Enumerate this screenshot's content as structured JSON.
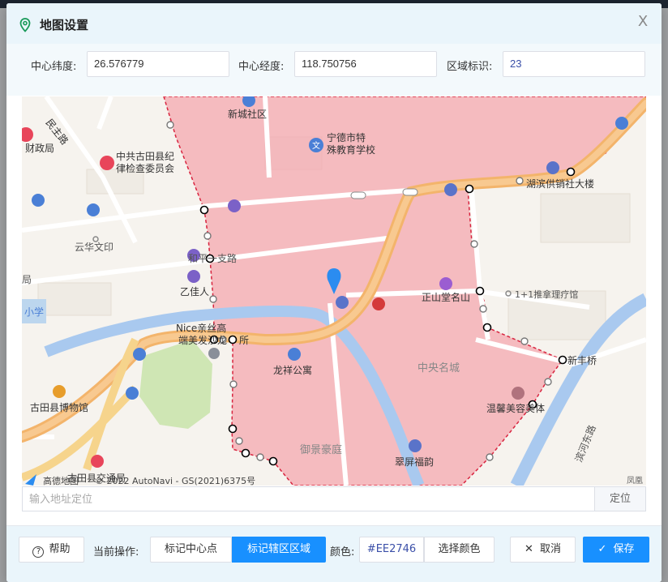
{
  "dialog": {
    "title": "地图设置",
    "close_symbol": "X"
  },
  "form": {
    "lat_label": "中心纬度:",
    "lat_value": "26.576779",
    "lng_label": "中心经度:",
    "lng_value": "118.750756",
    "area_label": "区域标识:",
    "area_value": "23"
  },
  "map": {
    "labels": {
      "xincheng": "新城社区",
      "minzhu": "民主路",
      "caizheng": "财政局",
      "jiwei_1": "中共古田县纪",
      "jiwei_2": "律检查委员会",
      "teshu_1": "宁德市特",
      "teshu_2": "殊教育学校",
      "gongxiao": "湖滨供销社大楼",
      "yunhua": "云华文印",
      "heping": "和平一支路",
      "yijia": "乙佳人",
      "zhengshan": "正山堂名山",
      "tuina": "1+1推拿理疗馆",
      "ju": "局",
      "xue": "小学",
      "nice_1": "Nice亲丝高",
      "nice_2": "端美发沙龙",
      "suo": "所",
      "longxiang": "龙祥公寓",
      "zhongyang": "中央名城",
      "xinfeng": "新丰桥",
      "bowuguan": "古田县博物馆",
      "wenxin": "温馨美容美体",
      "yujing": "御景豪庭",
      "cuiping": "翠屏福韵",
      "binhe": "滨河东路",
      "jiaotong": "古田县交通局",
      "fenghuang": "凤凰"
    },
    "copyright_brand": "高德地图",
    "copyright": "© 2022 AutoNavi - GS(2021)6375号",
    "region_color": "#EE2746"
  },
  "address": {
    "placeholder": "输入地址定位",
    "locate_label": "定位"
  },
  "footer": {
    "help_label": "帮助",
    "mode_label": "当前操作:",
    "mark_center_label": "标记中心点",
    "mark_area_label": "标记辖区区域",
    "color_label": "颜色:",
    "color_value": "#EE2746",
    "pick_color_label": "选择颜色",
    "cancel_label": "取消",
    "save_label": "保存"
  }
}
